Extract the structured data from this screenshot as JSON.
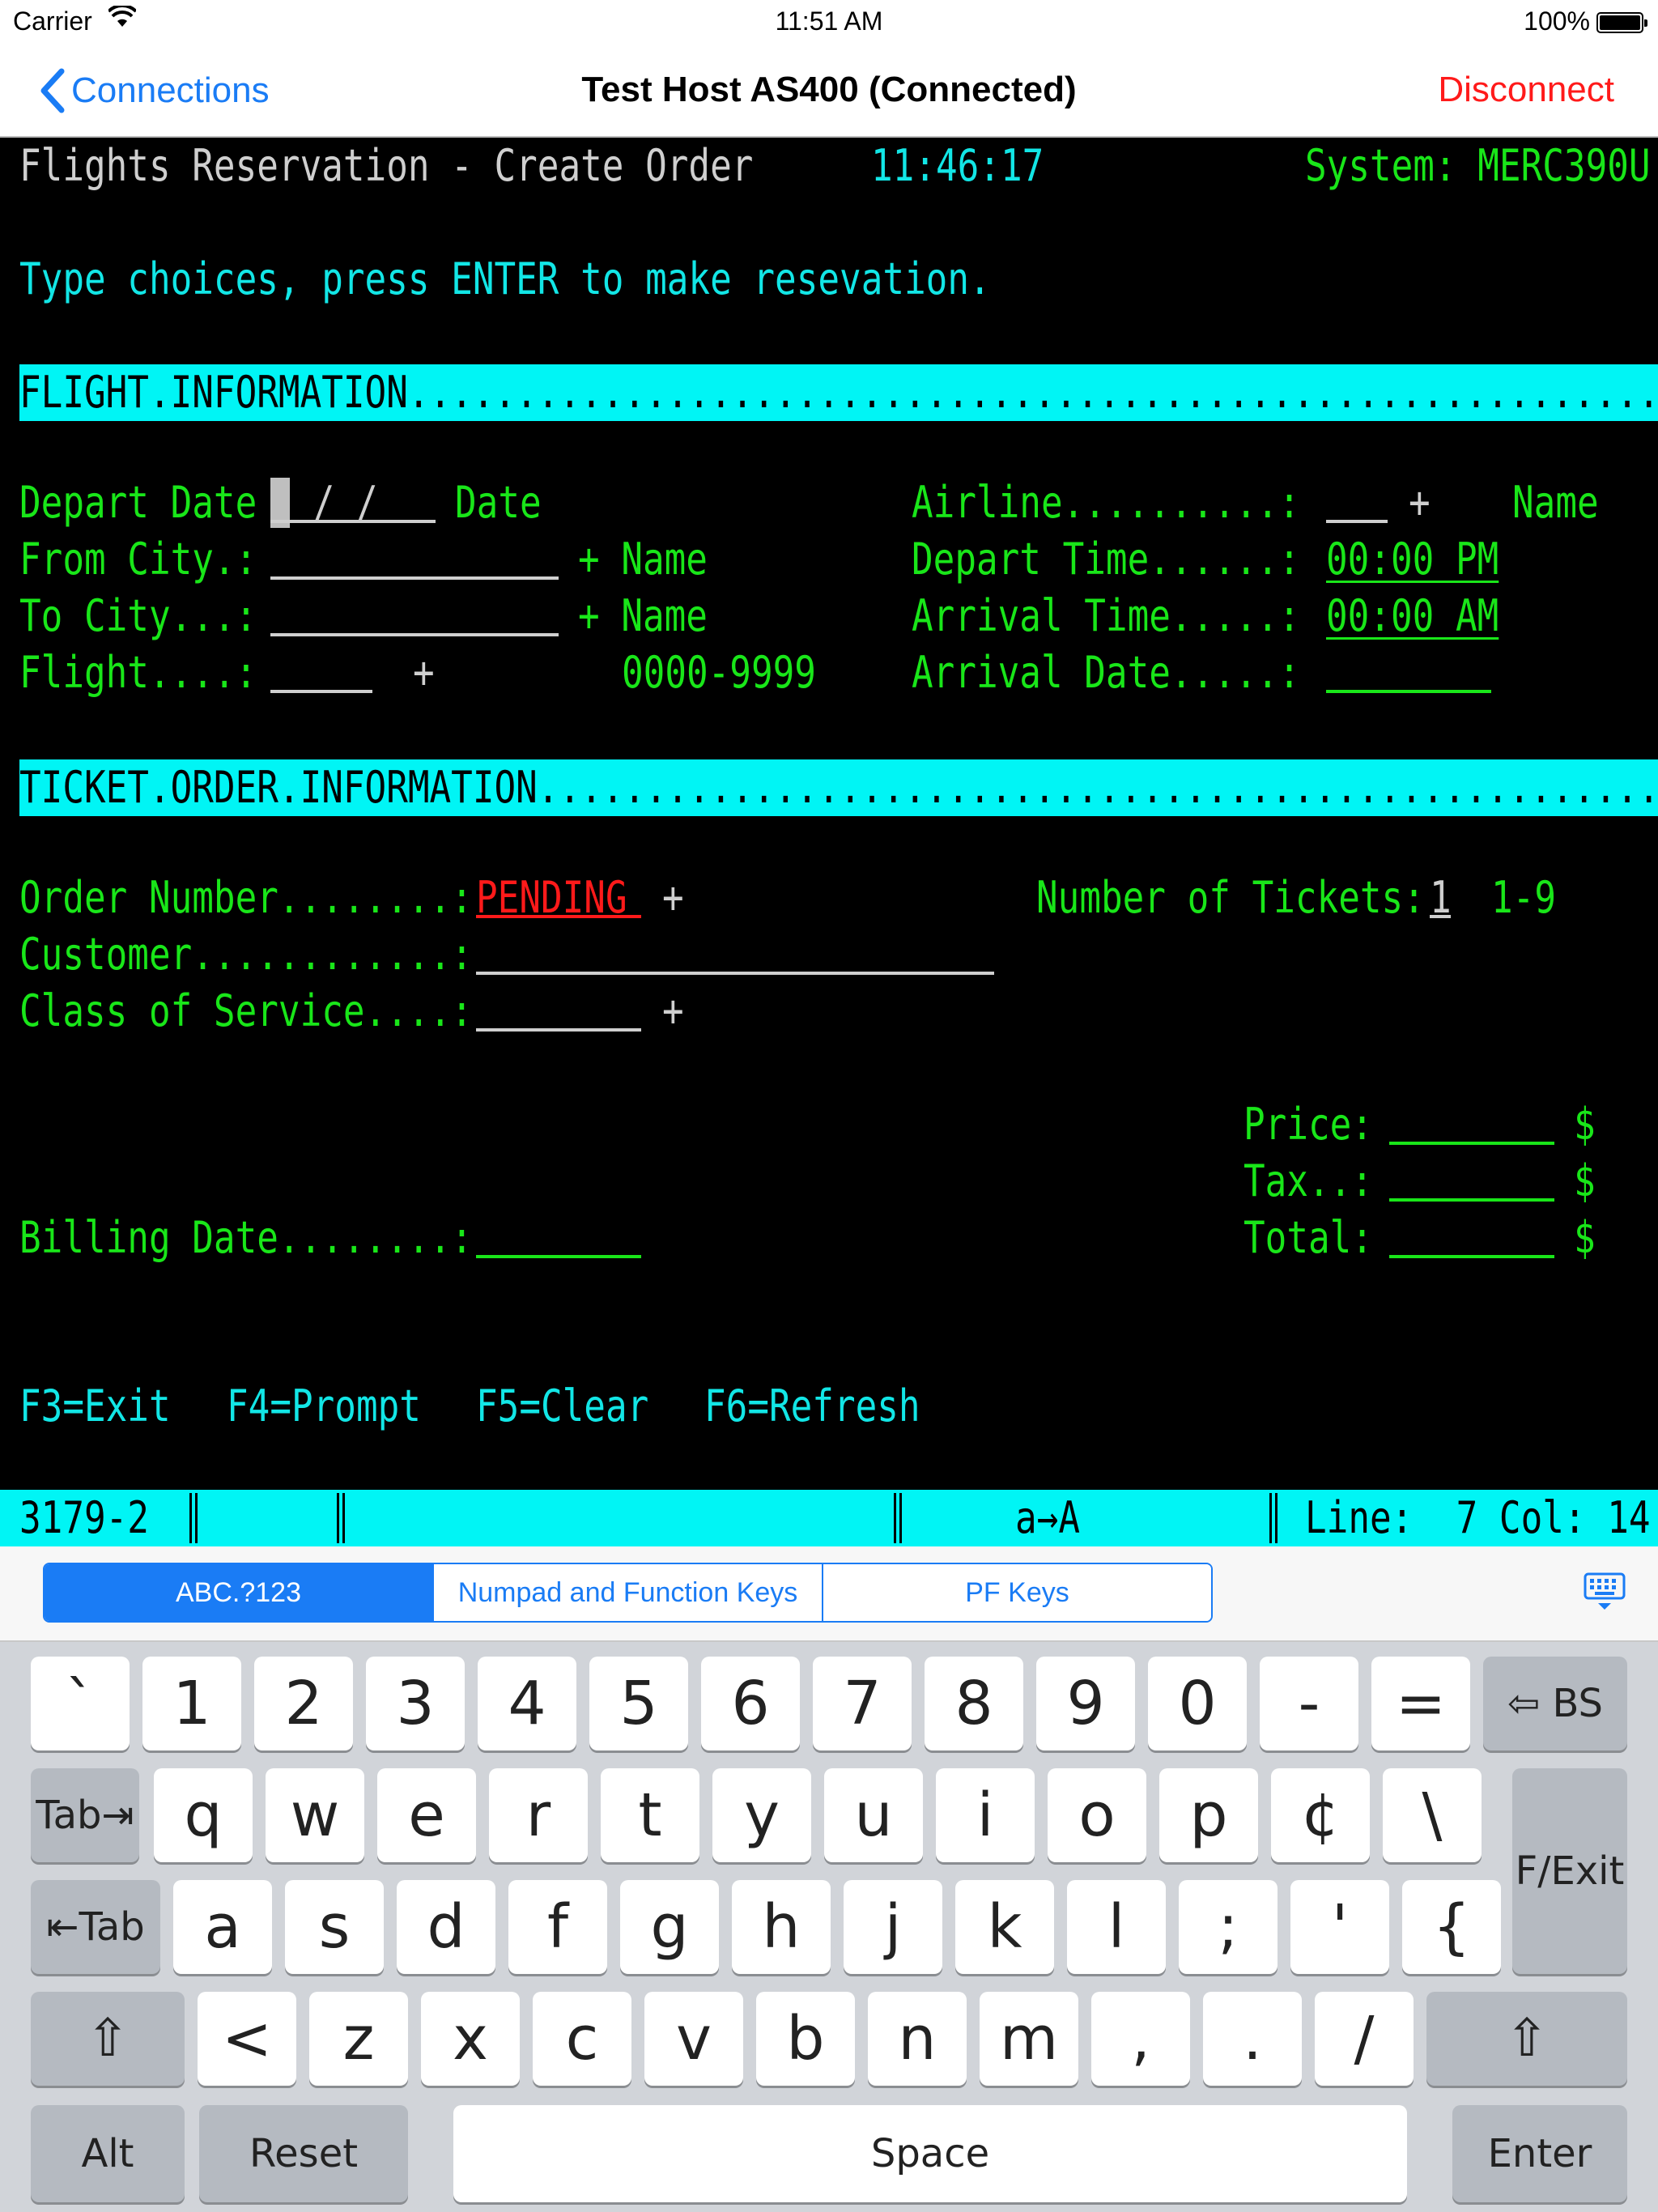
{
  "status_bar": {
    "carrier": "Carrier",
    "time": "11:51 AM",
    "battery": "100%"
  },
  "nav": {
    "back_label": "Connections",
    "title": "Test Host AS400 (Connected)",
    "action_label": "Disconnect"
  },
  "terminal": {
    "header_title": "Flights Reservation - Create Order",
    "header_time": "11:46:17",
    "header_system": "System: MERC390U",
    "instructions": "Type choices, press ENTER to make resevation.",
    "section_flight": "FLIGHT.INFORMATION..................................................................",
    "depart_date_label": "Depart Date",
    "depart_date_value": " / / ",
    "depart_date_hint": "Date",
    "from_city_label": "From City.:",
    "from_city_hint": "+ Name",
    "to_city_label": "To City...:",
    "to_city_hint": "+ Name",
    "flight_label": "Flight....:",
    "flight_plus": "+",
    "flight_hint": "0000-9999",
    "airline_label": "Airline..........:",
    "airline_plus": "+",
    "airline_hint": "Name",
    "depart_time_label": "Depart Time......:",
    "depart_time_value": "00:00 PM",
    "arrival_time_label": "Arrival Time.....:",
    "arrival_time_value": "00:00 AM",
    "arrival_date_label": "Arrival Date.....:",
    "section_ticket": "TICKET.ORDER.INFORMATION............................................................",
    "order_number_label": "Order Number........:",
    "order_number_value": "PENDING",
    "order_number_plus": "+",
    "tickets_label": "Number of Tickets:",
    "tickets_value": "1",
    "tickets_hint": "1-9",
    "customer_label": "Customer............:",
    "class_label": "Class of Service....:",
    "class_plus": "+",
    "price_label": "Price:",
    "tax_label": "Tax..:",
    "total_label": "Total:",
    "currency": "$",
    "billing_date_label": "Billing Date........:",
    "fkeys": [
      "F3=Exit",
      "F4=Prompt",
      "F5=Clear",
      "F6=Refresh"
    ]
  },
  "status_line": {
    "device": "3179-2",
    "mode": "a→A",
    "position": "Line:  7 Col: 14"
  },
  "keyboard_tabs": {
    "tabs": [
      "ABC.?123",
      "Numpad and Function Keys",
      "PF Keys"
    ],
    "active": "ABC.?123"
  },
  "keyboard": {
    "row1": [
      "`",
      "1",
      "2",
      "3",
      "4",
      "5",
      "6",
      "7",
      "8",
      "9",
      "0",
      "-",
      "="
    ],
    "bs": "⇦ BS",
    "tab_fwd": "Tab⇥",
    "row2": [
      "q",
      "w",
      "e",
      "r",
      "t",
      "y",
      "u",
      "i",
      "o",
      "p",
      "¢",
      "\\"
    ],
    "fexit": "F/Exit",
    "tab_back": "⇤Tab",
    "row3": [
      "a",
      "s",
      "d",
      "f",
      "g",
      "h",
      "j",
      "k",
      "l",
      ";",
      "'",
      "{"
    ],
    "shift": "⇧",
    "row4": [
      "<",
      "z",
      "x",
      "c",
      "v",
      "b",
      "n",
      "m",
      ",",
      ".",
      "/"
    ],
    "alt": "Alt",
    "reset": "Reset",
    "space": "Space",
    "enter": "Enter"
  },
  "colors": {
    "terminal_green": "#19e619",
    "terminal_cyan": "#12e6e6",
    "terminal_red": "#ff1a1a",
    "ios_blue": "#1a7cf5"
  }
}
